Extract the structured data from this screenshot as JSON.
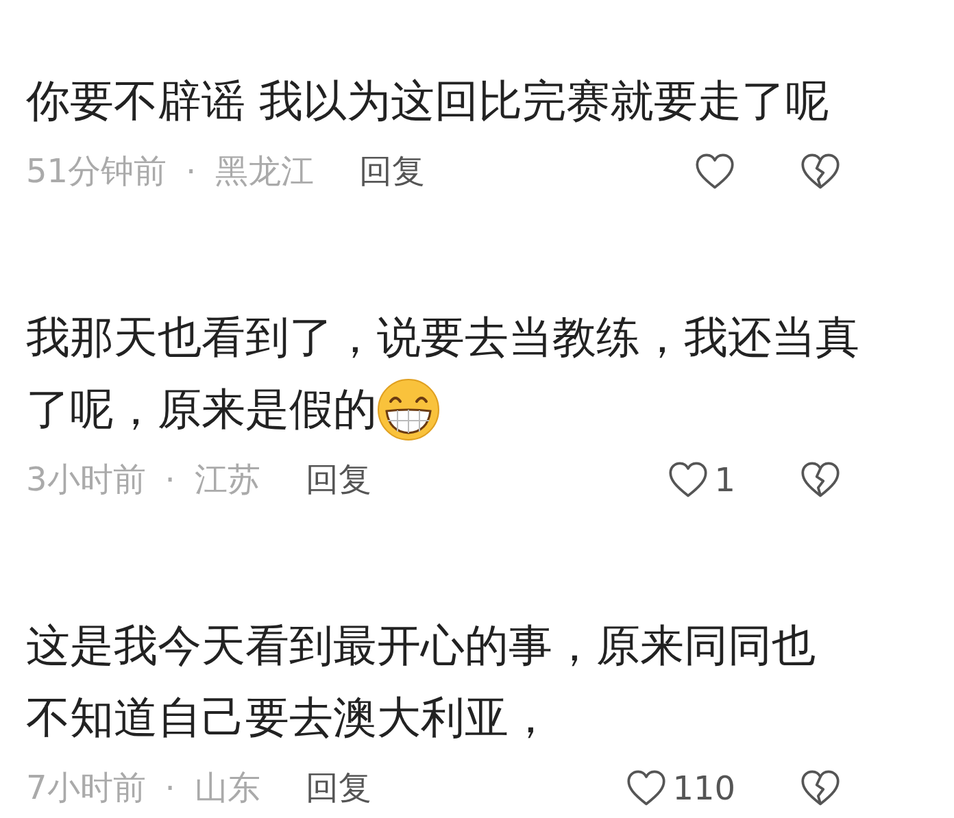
{
  "comments": [
    {
      "lines": [
        "你要不辟谣 我以为这回比完赛就要走了呢"
      ],
      "has_emoji": false,
      "time": "51分钟前",
      "separator": "·",
      "location": "黑龙江",
      "reply": "回复"
    },
    {
      "lines": [
        "我那天也看到了，说要去当教练，我还当真",
        "了呢，原来是假的"
      ],
      "has_emoji": true,
      "time": "3小时前",
      "separator": "·",
      "location": "江苏",
      "reply": "回复",
      "likes": "1"
    },
    {
      "lines": [
        "这是我今天看到最开心的事，原来同同也",
        "不知道自己要去澳大利亚，"
      ],
      "has_emoji": false,
      "time": "7小时前",
      "separator": "·",
      "location": "山东",
      "reply": "回复",
      "likes": "110"
    }
  ]
}
